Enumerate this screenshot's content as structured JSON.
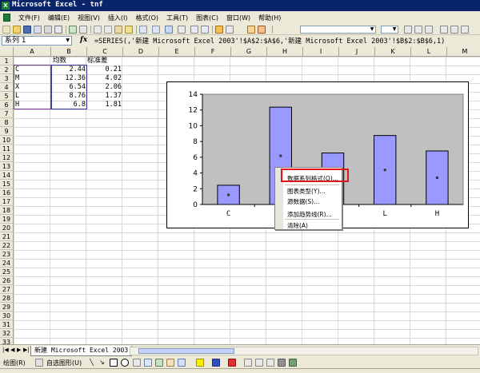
{
  "window": {
    "title": "Microsoft Excel - tnf"
  },
  "menu": [
    "文件(F)",
    "编辑(E)",
    "视图(V)",
    "插入(I)",
    "格式(O)",
    "工具(T)",
    "图表(C)",
    "窗口(W)",
    "帮助(H)"
  ],
  "formula_bar": {
    "name_box": "系列 1",
    "fx": "fx",
    "formula": "=SERIES(,'新建 Microsoft Excel 2003'!$A$2:$A$6,'新建 Microsoft Excel 2003'!$B$2:$B$6,1)"
  },
  "columns": [
    "A",
    "B",
    "C",
    "D",
    "E",
    "F",
    "G",
    "H",
    "I",
    "J",
    "K",
    "L",
    "M"
  ],
  "rows": [
    "1",
    "2",
    "3",
    "4",
    "5",
    "6",
    "7",
    "8",
    "9",
    "10",
    "11",
    "12",
    "13",
    "14",
    "15",
    "16",
    "17",
    "18",
    "19",
    "20",
    "21",
    "22",
    "23",
    "24",
    "25",
    "26",
    "27",
    "28",
    "29",
    "30",
    "31",
    "32",
    "33"
  ],
  "cells": {
    "B1": "均数",
    "C1": "标准差",
    "A2": "C",
    "B2": "2.44",
    "C2": "0.21",
    "A3": "M",
    "B3": "12.36",
    "C3": "4.02",
    "A4": "X",
    "B4": "6.54",
    "C4": "2.06",
    "A5": "L",
    "B5": "8.76",
    "C5": "1.37",
    "A6": "H",
    "B6": "6.8",
    "C6": "1.81"
  },
  "chart_data": {
    "type": "bar",
    "categories": [
      "C",
      "M",
      "X",
      "L",
      "H"
    ],
    "series": [
      {
        "values": [
          2.44,
          12.36,
          6.54,
          8.76,
          6.8
        ]
      }
    ],
    "ylim": [
      0,
      14
    ],
    "yticks": [
      "0",
      "2",
      "4",
      "6",
      "8",
      "10",
      "12",
      "14"
    ],
    "colors": {
      "bar": "#9999ff",
      "plot_area": "#c0c0c0",
      "bar_border": "#000000"
    },
    "title": "",
    "xlabel": "",
    "ylabel": ""
  },
  "context_menu": {
    "items": [
      "数据系列格式(O)...",
      "图表类型(Y)...",
      "源数据(S)...",
      "添加趋势线(R)...",
      "清除(A)"
    ],
    "highlighted_index": 0,
    "highlight_color": "#e0161b"
  },
  "sheet_tab": "新建 Microsoft Excel 2003",
  "draw_toolbar": {
    "draw_label": "绘图(R)",
    "autoshapes_label": "自选图形(U)"
  }
}
